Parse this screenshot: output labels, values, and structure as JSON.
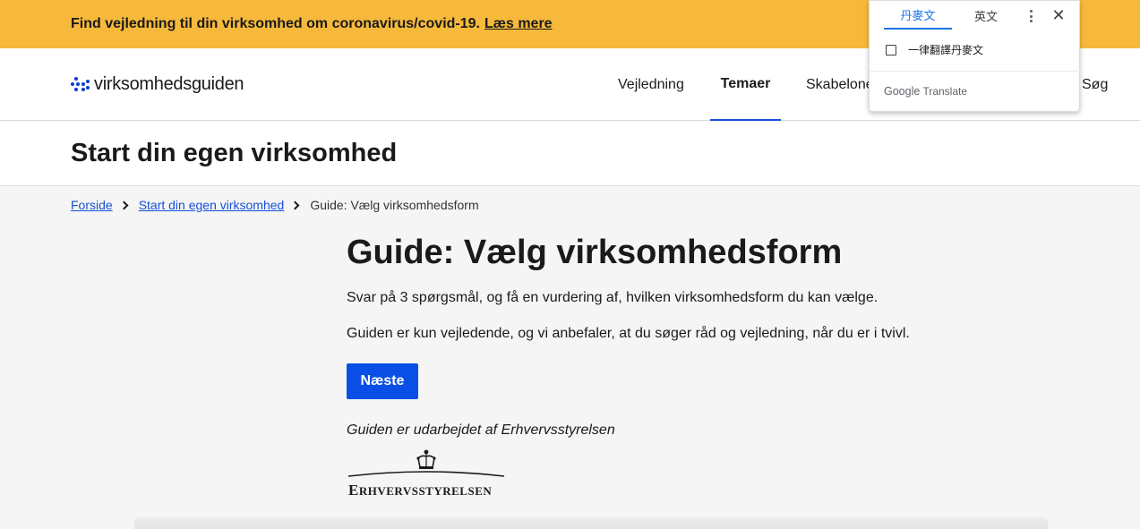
{
  "banner": {
    "text": "Find vejledning til din virksomhed om coronavirus/covid-19.",
    "link": "Læs mere",
    "color": "#f6b93b"
  },
  "header": {
    "logo_text": "virksomhedsguiden",
    "nav": [
      {
        "label": "Vejledning",
        "active": false
      },
      {
        "label": "Temaer",
        "active": true
      },
      {
        "label": "Skabelone",
        "active": false
      },
      {
        "label": "Søg",
        "active": false
      }
    ]
  },
  "page_title": "Start din egen virksomhed",
  "breadcrumb": {
    "items": [
      "Forside",
      "Start din egen virksomhed"
    ],
    "current": "Guide: Vælg virksomhedsform"
  },
  "main": {
    "heading": "Guide: Vælg virksomhedsform",
    "paragraph1": "Svar på 3 spørgsmål, og få en vurdering af, hvilken virksomhedsform du kan vælge.",
    "paragraph2": "Guiden er kun vejledende, og vi anbefaler, at du søger råd og vejledning, når du er i tvivl.",
    "next_button": "Næste",
    "credit": "Guiden er udarbejdet af Erhvervsstyrelsen",
    "agency_logo_text": "Erhvervsstyrelsen",
    "button_color": "#0a4fe5"
  },
  "translate_popup": {
    "tab_source": "丹麥文",
    "tab_target": "英文",
    "always_translate": "一律翻譯丹麥文",
    "brand_google": "Google",
    "brand_translate": "Translate"
  }
}
